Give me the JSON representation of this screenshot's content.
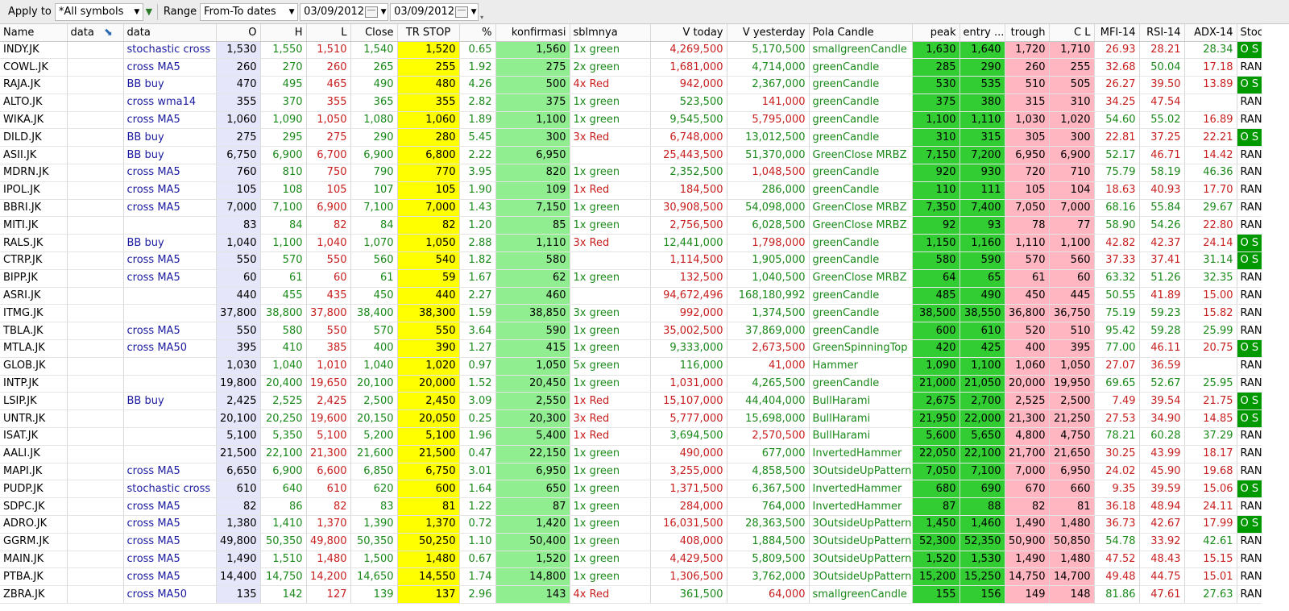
{
  "toolbar": {
    "apply_label": "Apply to",
    "apply_value": "*All symbols",
    "range_label": "Range",
    "range_value": "From-To dates",
    "date_from": "03/09/2012",
    "date_to": "03/09/2012"
  },
  "columns": [
    "Name",
    "data",
    "data",
    "O",
    "H",
    "L",
    "Close",
    "TR STOP",
    "%",
    "konfirmasi",
    "sblmnya",
    "V today",
    "V yesterday",
    "Pola Candle",
    "peak",
    "entry ...",
    "trough",
    "C L",
    "MFI-14",
    "RSI-14",
    "ADX-14",
    "Stochastic"
  ],
  "rows": [
    {
      "name": "INDY.JK",
      "data": "stochastic cross",
      "o": "1,530",
      "h": "1,550",
      "l": "1,510",
      "close": "1,540",
      "tr": "1,520",
      "pct": "0.65",
      "konf": "1,560",
      "sblm": "1x green",
      "vt": "4,269,500",
      "vy": "5,170,500",
      "pola": "smallgreenCandle",
      "peak": "1,630",
      "entry": "1,640",
      "trough": "1,720",
      "cl": "1,710",
      "mfi": "26.93",
      "rsi": "28.21",
      "adx": "28.34",
      "stoch": "O S"
    },
    {
      "name": "COWL.JK",
      "data": "cross MA5",
      "o": "260",
      "h": "270",
      "l": "260",
      "close": "265",
      "tr": "255",
      "pct": "1.92",
      "konf": "275",
      "sblm": "2x green",
      "vt": "1,681,000",
      "vy": "4,714,000",
      "pola": "greenCandle",
      "peak": "285",
      "entry": "290",
      "trough": "260",
      "cl": "255",
      "mfi": "32.68",
      "rsi": "50.04",
      "adx": "17.18",
      "stoch": "RANGE"
    },
    {
      "name": "RAJA.JK",
      "data": "BB buy",
      "o": "470",
      "h": "495",
      "l": "465",
      "close": "490",
      "tr": "480",
      "pct": "4.26",
      "konf": "500",
      "sblm": "4x Red",
      "vt": "942,000",
      "vy": "2,367,000",
      "pola": "greenCandle",
      "peak": "530",
      "entry": "535",
      "trough": "510",
      "cl": "505",
      "mfi": "26.27",
      "rsi": "39.50",
      "adx": "13.89",
      "stoch": "O S"
    },
    {
      "name": "ALTO.JK",
      "data": "cross wma14",
      "o": "355",
      "h": "370",
      "l": "355",
      "close": "365",
      "tr": "355",
      "pct": "2.82",
      "konf": "375",
      "sblm": "1x green",
      "vt": "523,500",
      "vy": "141,000",
      "pola": "greenCandle",
      "peak": "375",
      "entry": "380",
      "trough": "315",
      "cl": "310",
      "mfi": "34.25",
      "rsi": "47.54",
      "adx": "",
      "stoch": "RANGE"
    },
    {
      "name": "WIKA.JK",
      "data": "cross MA5",
      "o": "1,060",
      "h": "1,090",
      "l": "1,050",
      "close": "1,080",
      "tr": "1,060",
      "pct": "1.89",
      "konf": "1,100",
      "sblm": "1x green",
      "vt": "9,545,500",
      "vy": "5,795,000",
      "pola": "greenCandle",
      "peak": "1,100",
      "entry": "1,110",
      "trough": "1,030",
      "cl": "1,020",
      "mfi": "54.60",
      "rsi": "55.02",
      "adx": "16.89",
      "stoch": "RANGE"
    },
    {
      "name": "DILD.JK",
      "data": "BB buy",
      "o": "275",
      "h": "295",
      "l": "275",
      "close": "290",
      "tr": "280",
      "pct": "5.45",
      "konf": "300",
      "sblm": "3x Red",
      "vt": "6,748,000",
      "vy": "13,012,500",
      "pola": "greenCandle",
      "peak": "310",
      "entry": "315",
      "trough": "305",
      "cl": "300",
      "mfi": "22.81",
      "rsi": "37.25",
      "adx": "22.21",
      "stoch": "O S"
    },
    {
      "name": "ASII.JK",
      "data": "BB buy",
      "o": "6,750",
      "h": "6,900",
      "l": "6,700",
      "close": "6,900",
      "tr": "6,800",
      "pct": "2.22",
      "konf": "6,950",
      "sblm": "",
      "vt": "25,443,500",
      "vy": "51,370,000",
      "pola": "GreenClose MRBZ",
      "peak": "7,150",
      "entry": "7,200",
      "trough": "6,950",
      "cl": "6,900",
      "mfi": "52.17",
      "rsi": "46.71",
      "adx": "14.42",
      "stoch": "RANGE"
    },
    {
      "name": "MDRN.JK",
      "data": "cross MA5",
      "o": "760",
      "h": "810",
      "l": "750",
      "close": "790",
      "tr": "770",
      "pct": "3.95",
      "konf": "820",
      "sblm": "1x green",
      "vt": "2,352,500",
      "vy": "1,048,500",
      "pola": "greenCandle",
      "peak": "920",
      "entry": "930",
      "trough": "720",
      "cl": "710",
      "mfi": "75.79",
      "rsi": "58.19",
      "adx": "46.36",
      "stoch": "RANGE"
    },
    {
      "name": "IPOL.JK",
      "data": "cross MA5",
      "o": "105",
      "h": "108",
      "l": "105",
      "close": "107",
      "tr": "105",
      "pct": "1.90",
      "konf": "109",
      "sblm": "1x Red",
      "vt": "184,500",
      "vy": "286,000",
      "pola": "greenCandle",
      "peak": "110",
      "entry": "111",
      "trough": "105",
      "cl": "104",
      "mfi": "18.63",
      "rsi": "40.93",
      "adx": "17.70",
      "stoch": "RANGE"
    },
    {
      "name": "BBRI.JK",
      "data": "cross MA5",
      "o": "7,000",
      "h": "7,100",
      "l": "6,900",
      "close": "7,100",
      "tr": "7,000",
      "pct": "1.43",
      "konf": "7,150",
      "sblm": "1x green",
      "vt": "30,908,500",
      "vy": "54,098,000",
      "pola": "GreenClose MRBZ",
      "peak": "7,350",
      "entry": "7,400",
      "trough": "7,050",
      "cl": "7,000",
      "mfi": "68.16",
      "rsi": "55.84",
      "adx": "29.67",
      "stoch": "RANGE"
    },
    {
      "name": "MITI.JK",
      "data": "",
      "o": "83",
      "h": "84",
      "l": "82",
      "close": "84",
      "tr": "82",
      "pct": "1.20",
      "konf": "85",
      "sblm": "1x green",
      "vt": "2,756,500",
      "vy": "6,028,500",
      "pola": "GreenClose MRBZ",
      "peak": "92",
      "entry": "93",
      "trough": "78",
      "cl": "77",
      "mfi": "58.90",
      "rsi": "54.26",
      "adx": "22.80",
      "stoch": "RANGE"
    },
    {
      "name": "RALS.JK",
      "data": "BB buy",
      "o": "1,040",
      "h": "1,100",
      "l": "1,040",
      "close": "1,070",
      "tr": "1,050",
      "pct": "2.88",
      "konf": "1,110",
      "sblm": "3x Red",
      "vt": "12,441,000",
      "vy": "1,798,000",
      "pola": "greenCandle",
      "peak": "1,150",
      "entry": "1,160",
      "trough": "1,110",
      "cl": "1,100",
      "mfi": "42.82",
      "rsi": "42.37",
      "adx": "24.14",
      "stoch": "O S"
    },
    {
      "name": "CTRP.JK",
      "data": "cross MA5",
      "o": "550",
      "h": "570",
      "l": "550",
      "close": "560",
      "tr": "540",
      "pct": "1.82",
      "konf": "580",
      "sblm": "",
      "vt": "1,114,500",
      "vy": "1,905,000",
      "pola": "greenCandle",
      "peak": "580",
      "entry": "590",
      "trough": "570",
      "cl": "560",
      "mfi": "37.33",
      "rsi": "37.41",
      "adx": "31.14",
      "stoch": "O S"
    },
    {
      "name": "BIPP.JK",
      "data": "cross MA5",
      "o": "60",
      "h": "61",
      "l": "60",
      "close": "61",
      "tr": "59",
      "pct": "1.67",
      "konf": "62",
      "sblm": "1x green",
      "vt": "132,500",
      "vy": "1,040,500",
      "pola": "GreenClose MRBZ",
      "peak": "64",
      "entry": "65",
      "trough": "61",
      "cl": "60",
      "mfi": "63.32",
      "rsi": "51.26",
      "adx": "32.35",
      "stoch": "RANGE"
    },
    {
      "name": "ASRI.JK",
      "data": "",
      "o": "440",
      "h": "455",
      "l": "435",
      "close": "450",
      "tr": "440",
      "pct": "2.27",
      "konf": "460",
      "sblm": "",
      "vt": "94,672,496",
      "vy": "168,180,992",
      "pola": "greenCandle",
      "peak": "485",
      "entry": "490",
      "trough": "450",
      "cl": "445",
      "mfi": "50.55",
      "rsi": "41.89",
      "adx": "15.00",
      "stoch": "RANGE"
    },
    {
      "name": "ITMG.JK",
      "data": "",
      "o": "37,800",
      "h": "38,800",
      "l": "37,800",
      "close": "38,400",
      "tr": "38,300",
      "pct": "1.59",
      "konf": "38,850",
      "sblm": "3x green",
      "vt": "992,000",
      "vy": "1,374,500",
      "pola": "greenCandle",
      "peak": "38,500",
      "entry": "38,550",
      "trough": "36,800",
      "cl": "36,750",
      "mfi": "75.19",
      "rsi": "59.23",
      "adx": "15.82",
      "stoch": "RANGE"
    },
    {
      "name": "TBLA.JK",
      "data": "cross MA5",
      "o": "550",
      "h": "580",
      "l": "550",
      "close": "570",
      "tr": "550",
      "pct": "3.64",
      "konf": "590",
      "sblm": "1x green",
      "vt": "35,002,500",
      "vy": "37,869,000",
      "pola": "greenCandle",
      "peak": "600",
      "entry": "610",
      "trough": "520",
      "cl": "510",
      "mfi": "95.42",
      "rsi": "59.28",
      "adx": "25.99",
      "stoch": "RANGE"
    },
    {
      "name": "MTLA.JK",
      "data": "cross MA50",
      "o": "395",
      "h": "410",
      "l": "385",
      "close": "400",
      "tr": "390",
      "pct": "1.27",
      "konf": "415",
      "sblm": "1x green",
      "vt": "9,333,000",
      "vy": "2,673,500",
      "pola": "GreenSpinningTop",
      "peak": "420",
      "entry": "425",
      "trough": "400",
      "cl": "395",
      "mfi": "77.00",
      "rsi": "46.11",
      "adx": "20.75",
      "stoch": "O S"
    },
    {
      "name": "GLOB.JK",
      "data": "",
      "o": "1,030",
      "h": "1,040",
      "l": "1,010",
      "close": "1,040",
      "tr": "1,020",
      "pct": "0.97",
      "konf": "1,050",
      "sblm": "5x green",
      "vt": "116,000",
      "vy": "41,000",
      "pola": "Hammer",
      "peak": "1,090",
      "entry": "1,100",
      "trough": "1,060",
      "cl": "1,050",
      "mfi": "27.07",
      "rsi": "36.59",
      "adx": "",
      "stoch": "RANGE"
    },
    {
      "name": "INTP.JK",
      "data": "",
      "o": "19,800",
      "h": "20,400",
      "l": "19,650",
      "close": "20,100",
      "tr": "20,000",
      "pct": "1.52",
      "konf": "20,450",
      "sblm": "1x green",
      "vt": "1,031,000",
      "vy": "4,265,500",
      "pola": "greenCandle",
      "peak": "21,000",
      "entry": "21,050",
      "trough": "20,000",
      "cl": "19,950",
      "mfi": "69.65",
      "rsi": "52.67",
      "adx": "25.95",
      "stoch": "RANGE"
    },
    {
      "name": "LSIP.JK",
      "data": "BB buy",
      "o": "2,425",
      "h": "2,525",
      "l": "2,425",
      "close": "2,500",
      "tr": "2,450",
      "pct": "3.09",
      "konf": "2,550",
      "sblm": "1x Red",
      "vt": "15,107,000",
      "vy": "44,404,000",
      "pola": "BullHarami",
      "peak": "2,675",
      "entry": "2,700",
      "trough": "2,525",
      "cl": "2,500",
      "mfi": "7.49",
      "rsi": "39.54",
      "adx": "21.75",
      "stoch": "O S"
    },
    {
      "name": "UNTR.JK",
      "data": "",
      "o": "20,100",
      "h": "20,250",
      "l": "19,600",
      "close": "20,150",
      "tr": "20,050",
      "pct": "0.25",
      "konf": "20,300",
      "sblm": "3x Red",
      "vt": "5,777,000",
      "vy": "15,698,000",
      "pola": "BullHarami",
      "peak": "21,950",
      "entry": "22,000",
      "trough": "21,300",
      "cl": "21,250",
      "mfi": "27.53",
      "rsi": "34.90",
      "adx": "14.85",
      "stoch": "O S"
    },
    {
      "name": "ISAT.JK",
      "data": "",
      "o": "5,100",
      "h": "5,350",
      "l": "5,100",
      "close": "5,200",
      "tr": "5,100",
      "pct": "1.96",
      "konf": "5,400",
      "sblm": "1x Red",
      "vt": "3,694,500",
      "vy": "2,570,500",
      "pola": "BullHarami",
      "peak": "5,600",
      "entry": "5,650",
      "trough": "4,800",
      "cl": "4,750",
      "mfi": "78.21",
      "rsi": "60.28",
      "adx": "37.29",
      "stoch": "RANGE"
    },
    {
      "name": "AALI.JK",
      "data": "",
      "o": "21,500",
      "h": "22,100",
      "l": "21,300",
      "close": "21,600",
      "tr": "21,500",
      "pct": "0.47",
      "konf": "22,150",
      "sblm": "1x green",
      "vt": "490,000",
      "vy": "677,000",
      "pola": "InvertedHammer",
      "peak": "22,050",
      "entry": "22,100",
      "trough": "21,700",
      "cl": "21,650",
      "mfi": "30.25",
      "rsi": "43.99",
      "adx": "18.17",
      "stoch": "RANGE"
    },
    {
      "name": "MAPI.JK",
      "data": "cross MA5",
      "o": "6,650",
      "h": "6,900",
      "l": "6,600",
      "close": "6,850",
      "tr": "6,750",
      "pct": "3.01",
      "konf": "6,950",
      "sblm": "1x green",
      "vt": "3,255,000",
      "vy": "4,858,500",
      "pola": "3OutsideUpPattern",
      "peak": "7,050",
      "entry": "7,100",
      "trough": "7,000",
      "cl": "6,950",
      "mfi": "24.02",
      "rsi": "45.90",
      "adx": "19.68",
      "stoch": "RANGE"
    },
    {
      "name": "PUDP.JK",
      "data": "stochastic cross",
      "o": "610",
      "h": "640",
      "l": "610",
      "close": "620",
      "tr": "600",
      "pct": "1.64",
      "konf": "650",
      "sblm": "1x green",
      "vt": "1,371,500",
      "vy": "6,367,500",
      "pola": "InvertedHammer",
      "peak": "680",
      "entry": "690",
      "trough": "670",
      "cl": "660",
      "mfi": "9.35",
      "rsi": "39.59",
      "adx": "15.06",
      "stoch": "O S"
    },
    {
      "name": "SDPC.JK",
      "data": "cross MA5",
      "o": "82",
      "h": "86",
      "l": "82",
      "close": "83",
      "tr": "81",
      "pct": "1.22",
      "konf": "87",
      "sblm": "1x green",
      "vt": "284,000",
      "vy": "764,000",
      "pola": "InvertedHammer",
      "peak": "87",
      "entry": "88",
      "trough": "82",
      "cl": "81",
      "mfi": "36.18",
      "rsi": "48.94",
      "adx": "24.11",
      "stoch": "RANGE"
    },
    {
      "name": "ADRO.JK",
      "data": "cross MA5",
      "o": "1,380",
      "h": "1,410",
      "l": "1,370",
      "close": "1,390",
      "tr": "1,370",
      "pct": "0.72",
      "konf": "1,420",
      "sblm": "1x green",
      "vt": "16,031,500",
      "vy": "28,363,500",
      "pola": "3OutsideUpPattern",
      "peak": "1,450",
      "entry": "1,460",
      "trough": "1,490",
      "cl": "1,480",
      "mfi": "36.73",
      "rsi": "42.67",
      "adx": "17.99",
      "stoch": "O S"
    },
    {
      "name": "GGRM.JK",
      "data": "cross MA5",
      "o": "49,800",
      "h": "50,350",
      "l": "49,800",
      "close": "50,350",
      "tr": "50,250",
      "pct": "1.10",
      "konf": "50,400",
      "sblm": "1x green",
      "vt": "408,000",
      "vy": "1,884,500",
      "pola": "3OutsideUpPattern",
      "peak": "52,300",
      "entry": "52,350",
      "trough": "50,900",
      "cl": "50,850",
      "mfi": "54.78",
      "rsi": "33.92",
      "adx": "42.61",
      "stoch": "RANGE"
    },
    {
      "name": "MAIN.JK",
      "data": "cross MA5",
      "o": "1,490",
      "h": "1,510",
      "l": "1,480",
      "close": "1,500",
      "tr": "1,480",
      "pct": "0.67",
      "konf": "1,520",
      "sblm": "1x green",
      "vt": "4,429,500",
      "vy": "5,809,500",
      "pola": "3OutsideUpPattern",
      "peak": "1,520",
      "entry": "1,530",
      "trough": "1,490",
      "cl": "1,480",
      "mfi": "47.52",
      "rsi": "48.43",
      "adx": "15.15",
      "stoch": "RANGE"
    },
    {
      "name": "PTBA.JK",
      "data": "cross MA5",
      "o": "14,400",
      "h": "14,750",
      "l": "14,200",
      "close": "14,650",
      "tr": "14,550",
      "pct": "1.74",
      "konf": "14,800",
      "sblm": "1x green",
      "vt": "1,306,500",
      "vy": "3,762,000",
      "pola": "3OutsideUpPattern",
      "peak": "15,200",
      "entry": "15,250",
      "trough": "14,750",
      "cl": "14,700",
      "mfi": "49.48",
      "rsi": "44.75",
      "adx": "15.01",
      "stoch": "RANGE"
    },
    {
      "name": "ZBRA.JK",
      "data": "cross MA50",
      "o": "135",
      "h": "142",
      "l": "127",
      "close": "139",
      "tr": "137",
      "pct": "2.96",
      "konf": "143",
      "sblm": "4x Red",
      "vt": "361,500",
      "vy": "64,000",
      "pola": "smallgreenCandle",
      "peak": "155",
      "entry": "156",
      "trough": "149",
      "cl": "148",
      "mfi": "81.86",
      "rsi": "47.61",
      "adx": "27.63",
      "stoch": "RANGE"
    }
  ],
  "colors": {
    "o_bg": "#e6e6fa",
    "tr_stop_bg": "#ffff00",
    "konfirmasi_bg": "#90ee90",
    "peak_entry_bg": "#32cd32",
    "trough_cl_bg": "#ffb6c1",
    "stochastic_os_bg": "#009900",
    "text_green": "#1a8a1a",
    "text_red": "#c81e1e",
    "text_blue": "#1a1aa0"
  },
  "icons": {
    "apply_dropdown": "chevron-down-icon",
    "filter": "filter-icon",
    "sort": "sort-icon",
    "calendar": "calendar-icon",
    "resize_grip": "resize-grip-icon"
  }
}
